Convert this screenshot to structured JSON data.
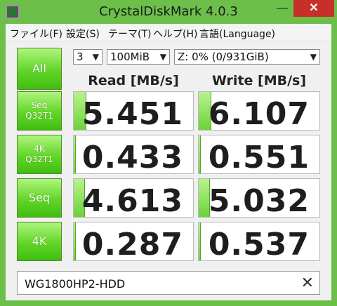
{
  "window": {
    "title": "CrystalDiskMark 4.0.3",
    "controls": {
      "minimize": "—",
      "maximize": "❐",
      "close": "✕"
    }
  },
  "menu": [
    "ファイル(F)",
    "設定(S)",
    "テーマ(T)",
    "ヘルプ(H)",
    "言語(Language)"
  ],
  "toolbar": {
    "all_label": "All",
    "runs": "3",
    "size": "100MiB",
    "drive": "Z: 0% (0/931GiB)",
    "dropdown_arrow": "v"
  },
  "headers": {
    "read": "Read [MB/s]",
    "write": "Write [MB/s]"
  },
  "tests": [
    {
      "label_line1": "Seq",
      "label_line2": "Q32T1",
      "read": "5.451",
      "write": "6.107",
      "read_fill": 0.1,
      "write_fill": 0.1
    },
    {
      "label_line1": "4K",
      "label_line2": "Q32T1",
      "read": "0.433",
      "write": "0.551",
      "read_fill": 0.01,
      "write_fill": 0.01
    },
    {
      "label_line1": "Seq",
      "label_line2": "",
      "read": "4.613",
      "write": "5.032",
      "read_fill": 0.09,
      "write_fill": 0.09
    },
    {
      "label_line1": "4K",
      "label_line2": "",
      "read": "0.287",
      "write": "0.537",
      "read_fill": 0.01,
      "write_fill": 0.01
    }
  ],
  "comment": {
    "value": "WG1800HP2-HDD",
    "clear_icon": "✕"
  },
  "colors": {
    "frame": "#6cc04a",
    "button_green": "#61d528",
    "bar_green": "#8be35a",
    "close": "#c7302a"
  }
}
